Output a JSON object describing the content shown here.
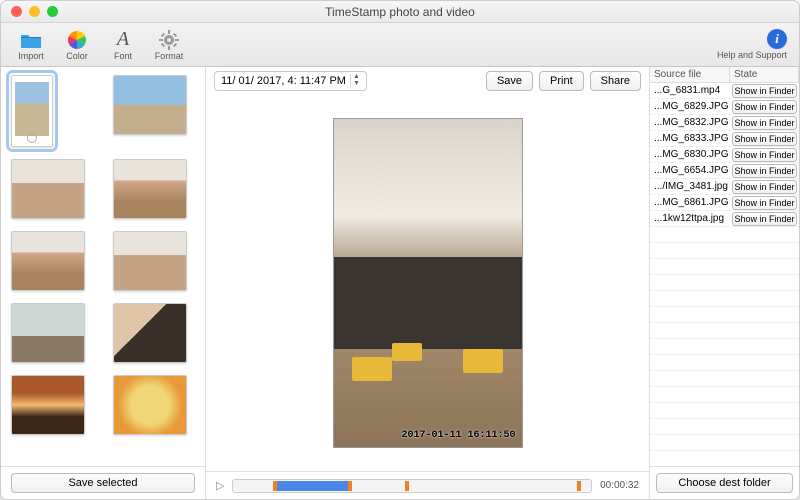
{
  "window": {
    "title": "TimeStamp photo and video"
  },
  "toolbar": {
    "import": "Import",
    "color": "Color",
    "font": "Font",
    "format": "Format",
    "help": "Help and Support"
  },
  "left": {
    "save_selected": "Save selected"
  },
  "center": {
    "datetime": "11/ 01/ 2017,   4: 11:47 PM",
    "save": "Save",
    "print": "Print",
    "share": "Share",
    "stamp": "2017-01-11 16:11:50",
    "timecode": "00:00:32"
  },
  "right": {
    "col_source": "Source file",
    "col_state": "State",
    "show_in_finder": "Show in Finder",
    "choose_dest": "Choose dest folder",
    "files": [
      "...G_6831.mp4",
      "...MG_6829.JPG",
      "...MG_6832.JPG",
      "...MG_6833.JPG",
      "...MG_6830.JPG",
      "...MG_6654.JPG",
      ".../IMG_3481.jpg",
      "...MG_6861.JPG",
      "...1kw12ttpa.jpg"
    ]
  }
}
